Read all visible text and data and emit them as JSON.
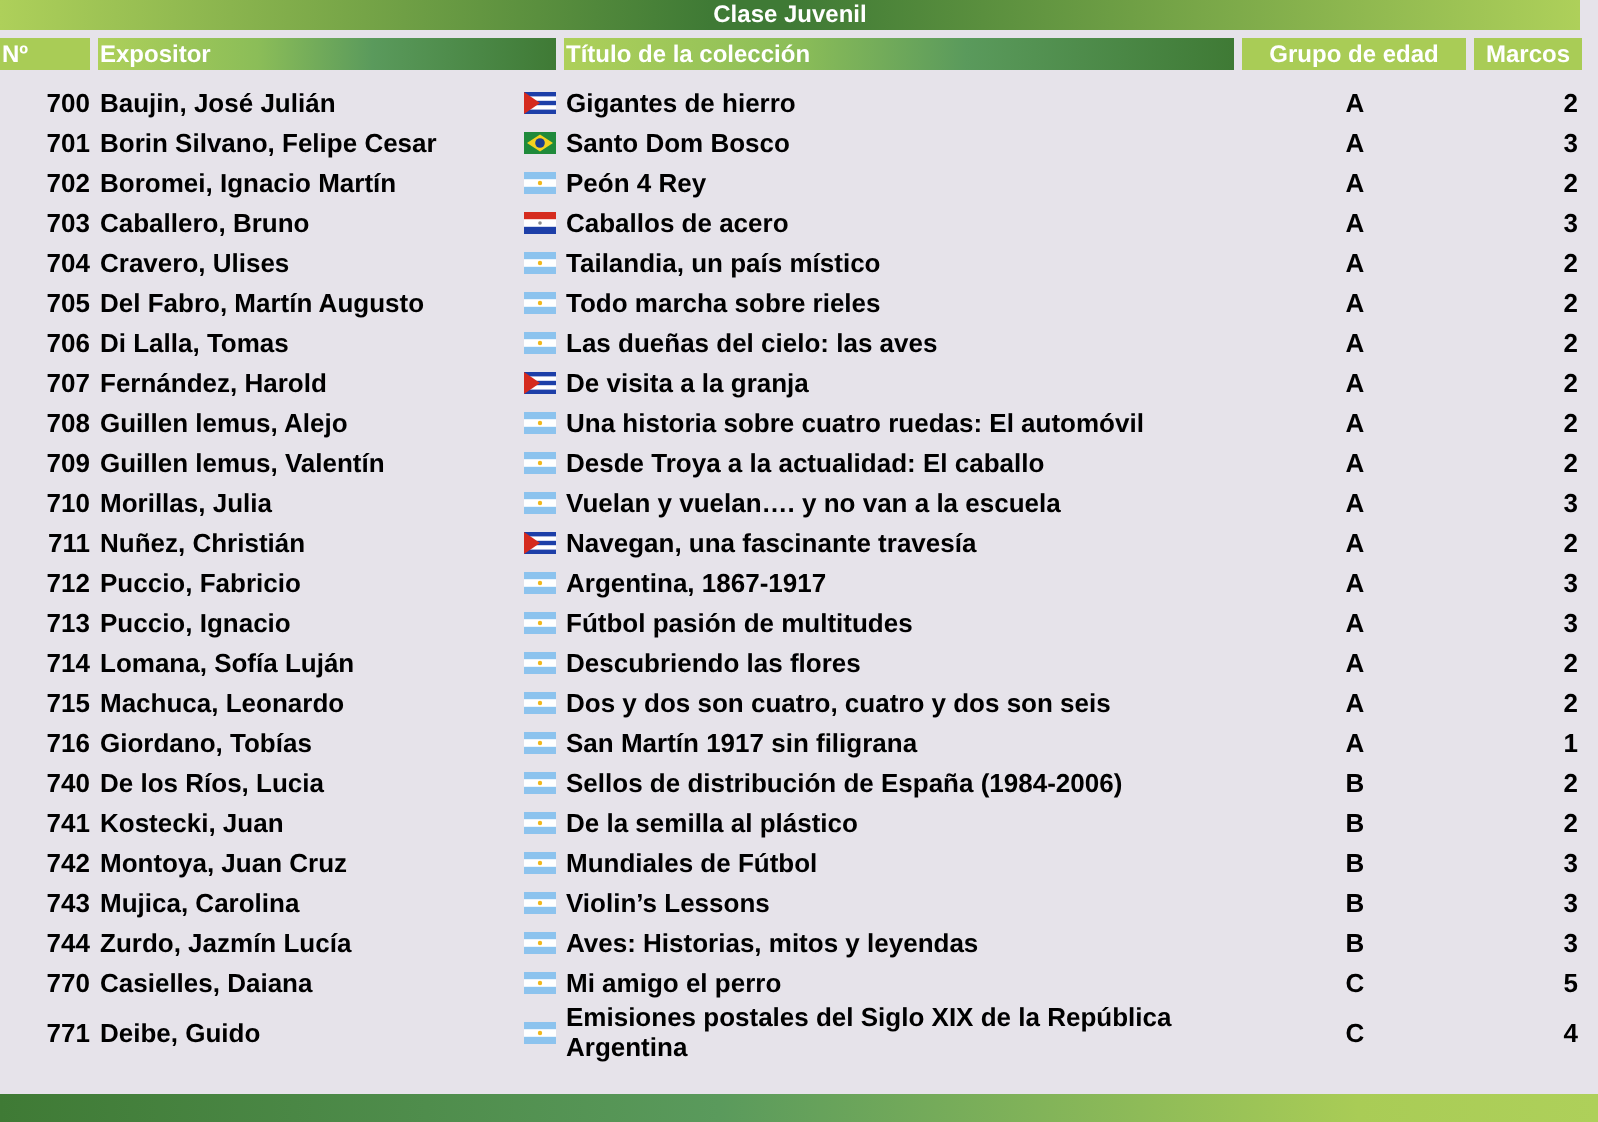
{
  "title": "Clase Juvenil",
  "columns": [
    "Nº",
    "Expositor",
    "Título de la colección",
    "Grupo de edad",
    "Marcos"
  ],
  "rows": [
    {
      "number": "700",
      "exhibitor": "Baujin, José Julián",
      "kind": "cuba",
      "title": "Gigantes de hierro",
      "group": "A",
      "frames": "2"
    },
    {
      "number": "701",
      "exhibitor": "Borin Silvano, Felipe Cesar",
      "kind": "brazil",
      "title": "Santo Dom Bosco",
      "group": "A",
      "frames": "3"
    },
    {
      "number": "702",
      "exhibitor": "Boromei, Ignacio Martín",
      "kind": "argentina",
      "title": "Peón 4 Rey",
      "group": "A",
      "frames": "2"
    },
    {
      "number": "703",
      "exhibitor": "Caballero, Bruno",
      "kind": "paraguay",
      "title": "Caballos de acero",
      "group": "A",
      "frames": "3"
    },
    {
      "number": "704",
      "exhibitor": "Cravero, Ulises",
      "kind": "argentina",
      "title": "Tailandia, un país místico",
      "group": "A",
      "frames": "2"
    },
    {
      "number": "705",
      "exhibitor": "Del Fabro, Martín Augusto",
      "kind": "argentina",
      "title": "Todo marcha sobre rieles",
      "group": "A",
      "frames": "2"
    },
    {
      "number": "706",
      "exhibitor": "Di Lalla, Tomas",
      "kind": "argentina",
      "title": "Las dueñas del cielo: las aves",
      "group": "A",
      "frames": "2"
    },
    {
      "number": "707",
      "exhibitor": "Fernández, Harold",
      "kind": "cuba",
      "title": "De visita a la granja",
      "group": "A",
      "frames": "2"
    },
    {
      "number": "708",
      "exhibitor": "Guillen lemus, Alejo",
      "kind": "argentina",
      "title": "Una historia sobre cuatro ruedas: El automóvil",
      "group": "A",
      "frames": "2"
    },
    {
      "number": "709",
      "exhibitor": "Guillen lemus, Valentín",
      "kind": "argentina",
      "title": "Desde Troya a la actualidad: El caballo",
      "group": "A",
      "frames": "2"
    },
    {
      "number": "710",
      "exhibitor": "Morillas, Julia",
      "kind": "argentina",
      "title": "Vuelan y vuelan…. y no van a la escuela",
      "group": "A",
      "frames": "3"
    },
    {
      "number": "711",
      "exhibitor": "Nuñez, Christián",
      "kind": "cuba",
      "title": "Navegan, una fascinante travesía",
      "group": "A",
      "frames": "2"
    },
    {
      "number": "712",
      "exhibitor": "Puccio, Fabricio",
      "kind": "argentina",
      "title": "Argentina, 1867-1917",
      "group": "A",
      "frames": "3"
    },
    {
      "number": "713",
      "exhibitor": "Puccio, Ignacio",
      "kind": "argentina",
      "title": "Fútbol pasión de multitudes",
      "group": "A",
      "frames": "3"
    },
    {
      "number": "714",
      "exhibitor": "Lomana, Sofía Luján",
      "kind": "argentina",
      "title": "Descubriendo las flores",
      "group": "A",
      "frames": "2"
    },
    {
      "number": "715",
      "exhibitor": "Machuca, Leonardo",
      "kind": "argentina",
      "title": "Dos y dos son cuatro, cuatro y dos son seis",
      "group": "A",
      "frames": "2"
    },
    {
      "number": "716",
      "exhibitor": "Giordano, Tobías",
      "kind": "argentina",
      "title": "San Martín 1917 sin filigrana",
      "group": "A",
      "frames": "1"
    },
    {
      "number": "740",
      "exhibitor": "De los Ríos, Lucia",
      "kind": "argentina",
      "title": "Sellos de distribución de España (1984-2006)",
      "group": "B",
      "frames": "2"
    },
    {
      "number": "741",
      "exhibitor": "Kostecki, Juan",
      "kind": "argentina",
      "title": "De la semilla al plástico",
      "group": "B",
      "frames": "2"
    },
    {
      "number": "742",
      "exhibitor": "Montoya, Juan Cruz",
      "kind": "argentina",
      "title": "Mundiales de Fútbol",
      "group": "B",
      "frames": "3"
    },
    {
      "number": "743",
      "exhibitor": "Mujica, Carolina",
      "kind": "argentina",
      "title": "Violin’s Lessons",
      "group": "B",
      "frames": "3"
    },
    {
      "number": "744",
      "exhibitor": "Zurdo, Jazmín Lucía",
      "kind": "argentina",
      "title": "Aves: Historias, mitos y leyendas",
      "group": "B",
      "frames": "3"
    },
    {
      "number": "770",
      "exhibitor": "Casielles, Daiana",
      "kind": "argentina",
      "title": "Mi amigo el perro",
      "group": "C",
      "frames": "5"
    },
    {
      "number": "771",
      "exhibitor": "Deibe, Guido",
      "kind": "argentina",
      "title": "Emisiones postales del Siglo XIX de la República Argentina",
      "group": "C",
      "frames": "4"
    }
  ]
}
